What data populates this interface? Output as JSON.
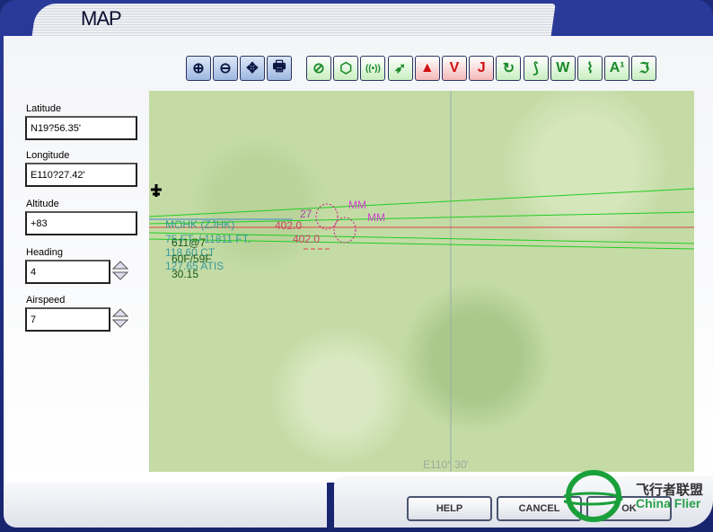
{
  "window": {
    "title": "MAP"
  },
  "fields": [
    {
      "label": "Latitude",
      "value": "N19?56.35'"
    },
    {
      "label": "Longitude",
      "value": "E110?27.42'"
    },
    {
      "label": "Altitude",
      "value": "+83"
    },
    {
      "label": "Heading",
      "value": "4"
    },
    {
      "label": "Airspeed",
      "value": "7"
    }
  ],
  "toolbar": {
    "view_tools": [
      "zoom-in",
      "zoom-out",
      "center",
      "print"
    ],
    "layer_tools": [
      {
        "icon": "airport",
        "glyph": "⊘"
      },
      {
        "icon": "ndb",
        "glyph": "⬡"
      },
      {
        "icon": "vor",
        "glyph": "((•))"
      },
      {
        "icon": "flight-plan",
        "glyph": "➶"
      },
      {
        "icon": "obstacle",
        "glyph": "▲"
      },
      {
        "icon": "victor-airways",
        "glyph": "V"
      },
      {
        "icon": "jet-airways",
        "glyph": "J"
      },
      {
        "icon": "holding",
        "glyph": "↻"
      },
      {
        "icon": "route",
        "glyph": "⟆"
      },
      {
        "icon": "weather",
        "glyph": "W"
      },
      {
        "icon": "terrain",
        "glyph": "⌇"
      },
      {
        "icon": "altitude",
        "glyph": "A¹"
      },
      {
        "icon": "approaches",
        "glyph": "ℑ"
      }
    ]
  },
  "map": {
    "airport_name": "MOHK (ZJHK)",
    "elevation": "75 FT. / 11811 FT.",
    "wind": "611@7",
    "tower_freq": "118.60 CT",
    "temp": "60F/59F",
    "atis_freq": "127.65 ATIS",
    "altimeter": "30.15",
    "ils_freq_1": "402.0",
    "ils_freq_2": "402.0",
    "runway": "27",
    "marker_1": "MM",
    "marker_2": "MM",
    "meridian_label": "E110° 30'"
  },
  "buttons": {
    "help": "HELP",
    "cancel": "CANCEL",
    "ok": "OK"
  },
  "watermark": {
    "cn": "飞行者联盟",
    "en": "China Flier"
  },
  "colors": {
    "frame": "#1c2a78",
    "runway_lines": "#22cc22",
    "ils": "#cc2288",
    "text": "#2a8a8a"
  }
}
